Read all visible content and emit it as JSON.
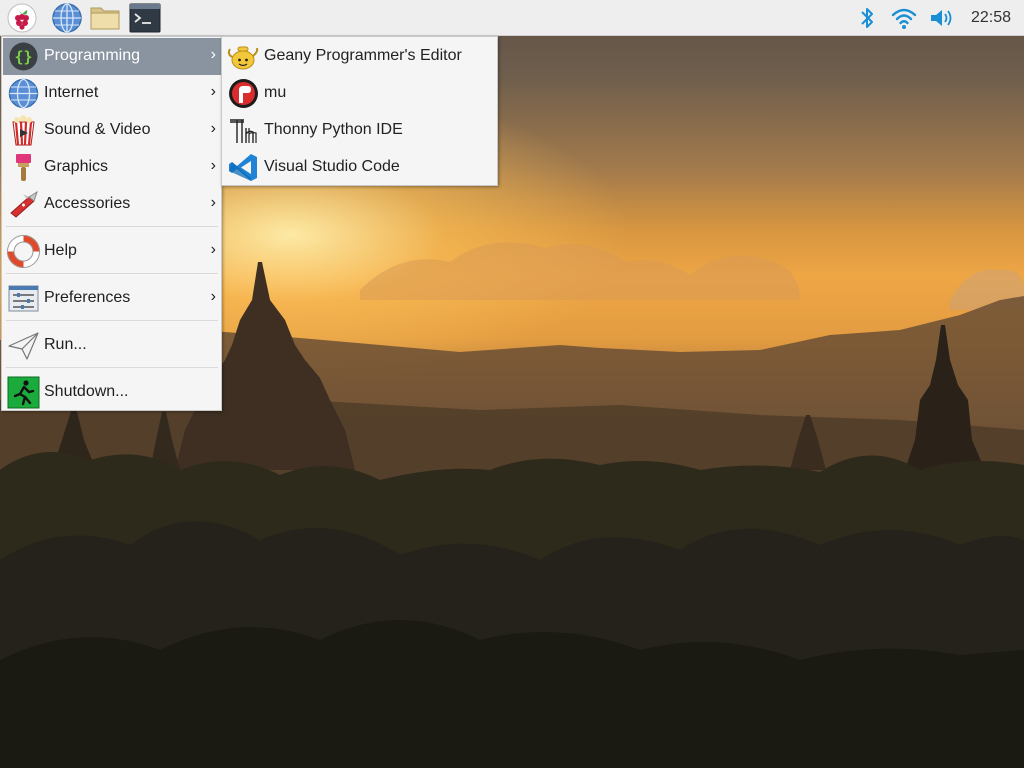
{
  "taskbar": {
    "launchers": [
      {
        "name": "raspberry-menu",
        "icon": "raspberry-icon"
      },
      {
        "name": "web-browser",
        "icon": "globe-icon"
      },
      {
        "name": "file-manager",
        "icon": "folder-icon"
      },
      {
        "name": "terminal",
        "icon": "terminal-icon"
      }
    ],
    "tray": {
      "bluetooth_icon": "bluetooth-icon",
      "wifi_icon": "wifi-icon",
      "volume_icon": "volume-icon",
      "clock": "22:58"
    }
  },
  "menu": {
    "items": [
      {
        "label": "Programming",
        "icon": "programming-braces-icon",
        "submenu": true,
        "active": true
      },
      {
        "label": "Internet",
        "icon": "globe-icon",
        "submenu": true
      },
      {
        "label": "Sound & Video",
        "icon": "popcorn-icon",
        "submenu": true
      },
      {
        "label": "Graphics",
        "icon": "paintbrush-icon",
        "submenu": true
      },
      {
        "label": "Accessories",
        "icon": "pocket-knife-icon",
        "submenu": true
      },
      {
        "label": "Help",
        "icon": "lifebuoy-icon",
        "submenu": true
      },
      {
        "label": "Preferences",
        "icon": "sliders-icon",
        "submenu": true
      },
      {
        "label": "Run...",
        "icon": "paper-plane-icon",
        "submenu": false
      },
      {
        "label": "Shutdown...",
        "icon": "running-exit-icon",
        "submenu": false
      }
    ],
    "arrow_glyph": "›"
  },
  "submenu": {
    "items": [
      {
        "label": "Geany Programmer's Editor",
        "icon": "geany-teapot-icon"
      },
      {
        "label": "mu",
        "icon": "mu-icon"
      },
      {
        "label": "Thonny Python IDE",
        "icon": "thonny-icon"
      },
      {
        "label": "Visual Studio Code",
        "icon": "vscode-icon"
      }
    ]
  },
  "colors": {
    "panel_bg": "#eeeeee",
    "menu_bg": "#f5f5f5",
    "menu_highlight": "#8a94a0",
    "tray_blue": "#1a8fd6"
  }
}
